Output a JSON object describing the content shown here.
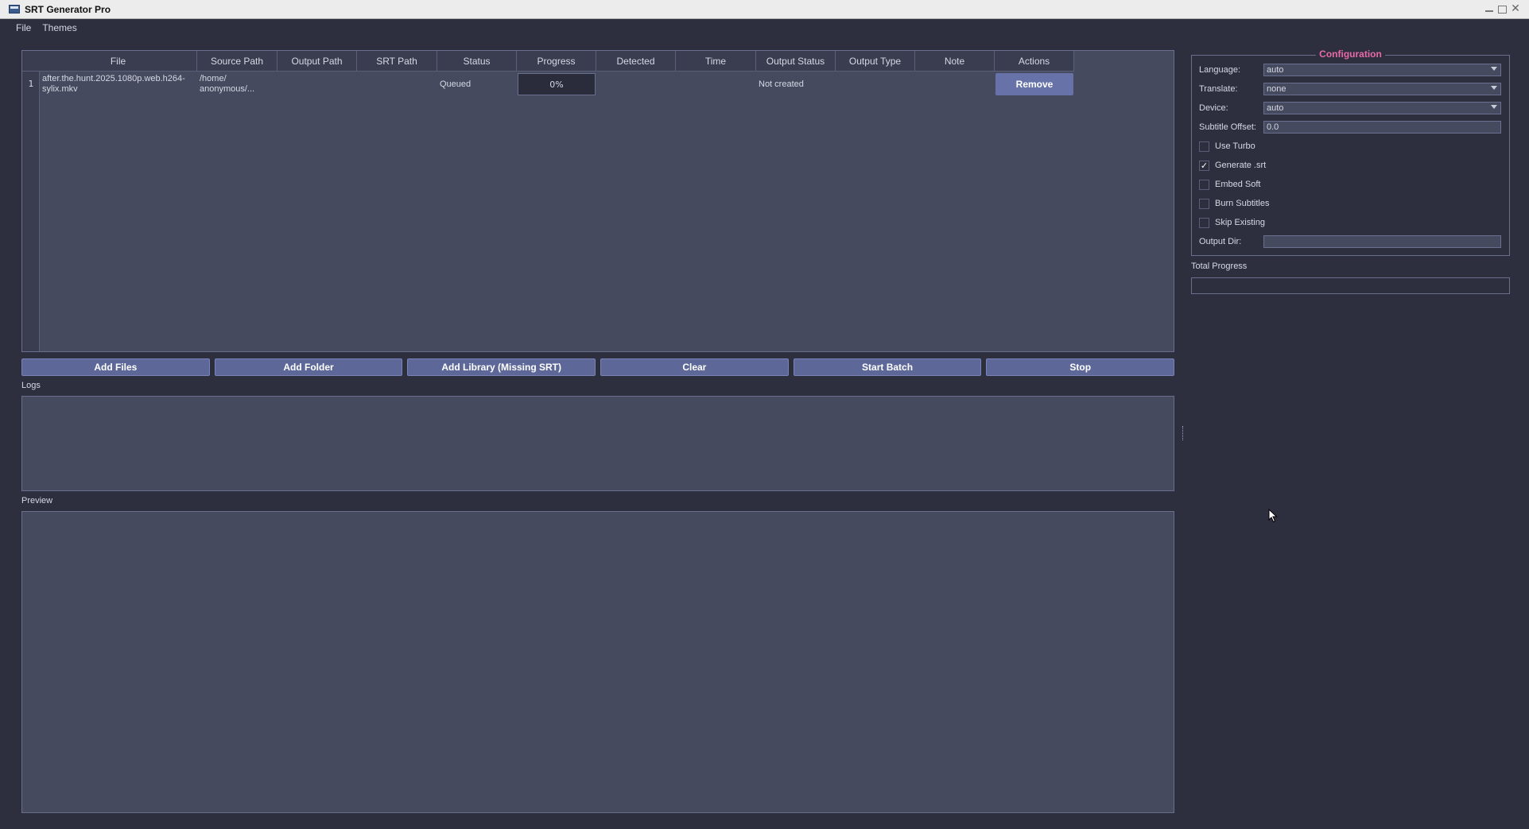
{
  "window": {
    "title": "SRT Generator Pro"
  },
  "menu": {
    "items": [
      "File",
      "Themes"
    ]
  },
  "table": {
    "columns": [
      "File",
      "Source Path",
      "Output Path",
      "SRT Path",
      "Status",
      "Progress",
      "Detected",
      "Time",
      "Output Status",
      "Output Type",
      "Note",
      "Actions"
    ],
    "rows": [
      {
        "num": "1",
        "file": "after.the.hunt.2025.1080p.web.h264-sylix.mkv",
        "source_path": "/home/\nanonymous/...",
        "output_path": "",
        "srt_path": "",
        "status": "Queued",
        "progress": "0%",
        "detected": "",
        "time": "",
        "output_status": "Not created",
        "output_type": "",
        "note": "",
        "action": "Remove"
      }
    ]
  },
  "buttons": {
    "add_files": "Add Files",
    "add_folder": "Add Folder",
    "add_library": "Add Library (Missing SRT)",
    "clear": "Clear",
    "start_batch": "Start Batch",
    "stop": "Stop"
  },
  "logs": {
    "label": "Logs"
  },
  "preview": {
    "label": "Preview"
  },
  "config": {
    "title": "Configuration",
    "language_label": "Language:",
    "language_value": "auto",
    "translate_label": "Translate:",
    "translate_value": "none",
    "device_label": "Device:",
    "device_value": "auto",
    "offset_label": "Subtitle Offset:",
    "offset_value": "0.0",
    "use_turbo": {
      "label": "Use Turbo",
      "checked": false
    },
    "generate_srt": {
      "label": "Generate .srt",
      "checked": true
    },
    "embed_soft": {
      "label": "Embed Soft",
      "checked": false
    },
    "burn_subtitles": {
      "label": "Burn Subtitles",
      "checked": false
    },
    "skip_existing": {
      "label": "Skip Existing",
      "checked": false
    },
    "output_dir_label": "Output Dir:",
    "output_dir_value": ""
  },
  "total_progress": {
    "label": "Total Progress",
    "value": 0
  },
  "colors": {
    "background": "#2d2f3e",
    "panel": "#464a5e",
    "button": "#5d6898",
    "accent_title": "#e86aa8"
  }
}
